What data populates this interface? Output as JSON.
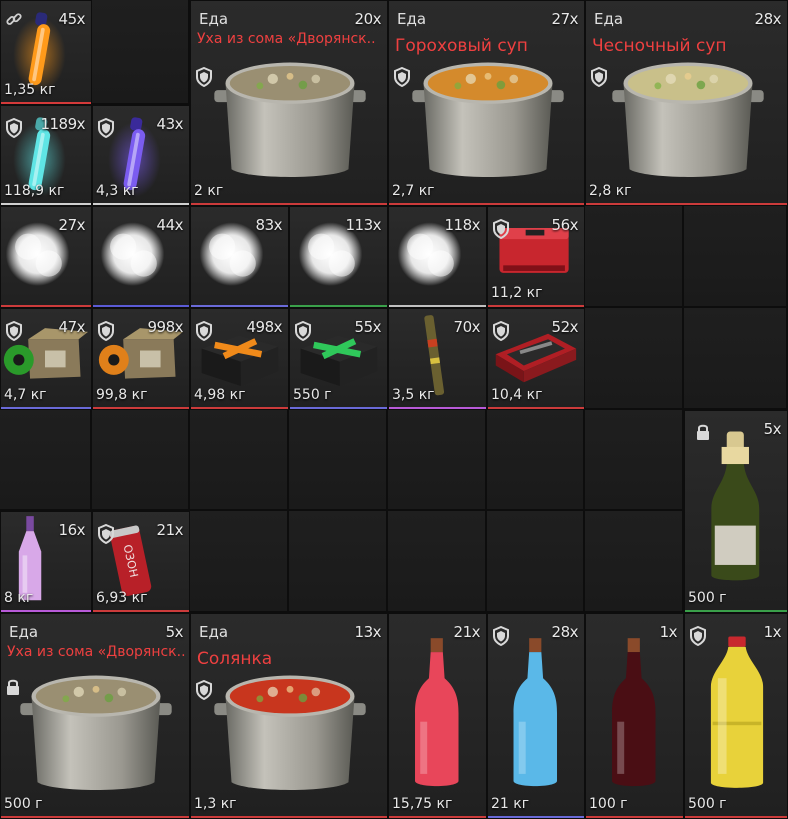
{
  "inventory": {
    "items": [
      {
        "id": "glow-orange",
        "kind": "glowstick",
        "count": "45x",
        "weight": "1,35 кг",
        "colors": {
          "tube": "#ff9a1a",
          "cap": "#2a2a78"
        },
        "rarity": "#d43a3a",
        "icon": "chain-link-icon"
      },
      {
        "id": "soup-ukha-1",
        "kind": "soup",
        "category": "Еда",
        "name": "Уха из сома «Дворянск..",
        "count": "20x",
        "weight": "2 кг",
        "colors": {
          "broth": "#9a8f72"
        },
        "rarity": "#cc3b3b",
        "icon": "shield-icon"
      },
      {
        "id": "soup-pea",
        "kind": "soup",
        "category": "Еда",
        "name": "Гороховый суп",
        "count": "27x",
        "weight": "2,7 кг",
        "colors": {
          "broth": "#d48a2c"
        },
        "rarity": "#cc3b3b",
        "icon": "shield-icon"
      },
      {
        "id": "soup-garlic",
        "kind": "soup",
        "category": "Еда",
        "name": "Чесночный суп",
        "count": "28x",
        "weight": "2,8 кг",
        "colors": {
          "broth": "#c9c08a"
        },
        "rarity": "#cc3b3b",
        "icon": "shield-icon"
      },
      {
        "id": "glow-cyan",
        "kind": "glowstick",
        "count": "1189x",
        "weight": "118,9 кг",
        "colors": {
          "tube": "#5fe5e5",
          "cap": "#4aa8a8"
        },
        "rarity": "#cfcfcf",
        "icon": "shield-icon"
      },
      {
        "id": "glow-purple",
        "kind": "glowstick",
        "count": "43x",
        "weight": "4,3 кг",
        "colors": {
          "tube": "#7b5cf0",
          "cap": "#3a2a9a"
        },
        "rarity": "#cfcfcf",
        "icon": "shield-icon"
      },
      {
        "id": "smoke-1",
        "kind": "smoke",
        "count": "27x",
        "weight": "",
        "rarity": "#cc3b3b"
      },
      {
        "id": "smoke-2",
        "kind": "smoke",
        "count": "44x",
        "weight": "",
        "rarity": "#5b5bd6"
      },
      {
        "id": "smoke-3",
        "kind": "smoke",
        "count": "83x",
        "weight": "",
        "rarity": "#6a6ad8"
      },
      {
        "id": "smoke-4",
        "kind": "smoke",
        "count": "113x",
        "weight": "",
        "rarity": "#3aa04a"
      },
      {
        "id": "smoke-5",
        "kind": "smoke",
        "count": "118x",
        "weight": "",
        "rarity": "#c0c0c0"
      },
      {
        "id": "case-red",
        "kind": "case",
        "count": "56x",
        "weight": "11,2 кг",
        "colors": {
          "body": "#c8262e"
        },
        "rarity": "#cc3b3b",
        "icon": "shield-icon"
      },
      {
        "id": "ammo-green",
        "kind": "ammobox",
        "count": "47x",
        "weight": "4,7 кг",
        "colors": {
          "tape": "#2a9a2a"
        },
        "rarity": "#6a6ad8",
        "icon": "shield-icon"
      },
      {
        "id": "ammo-orange",
        "kind": "ammobox",
        "count": "998x",
        "weight": "99,8 кг",
        "colors": {
          "tape": "#e0801a"
        },
        "rarity": "#cc3b3b",
        "icon": "shield-icon"
      },
      {
        "id": "kit-orange",
        "kind": "kit",
        "count": "498x",
        "weight": "4,98 кг",
        "colors": {
          "x": "#f08a1a"
        },
        "rarity": "#cc3b3b",
        "icon": "shield-icon"
      },
      {
        "id": "kit-green",
        "kind": "kit",
        "count": "55x",
        "weight": "550 г",
        "colors": {
          "x": "#2fc85a"
        },
        "rarity": "#6a6ad8",
        "icon": "shield-icon"
      },
      {
        "id": "flare",
        "kind": "flare",
        "count": "70x",
        "weight": "3,5 кг",
        "rarity": "#b85ad8"
      },
      {
        "id": "case-tools",
        "kind": "toolcase",
        "count": "52x",
        "weight": "10,4 кг",
        "colors": {
          "body": "#b01e24"
        },
        "rarity": "#cc3b3b",
        "icon": "shield-icon"
      },
      {
        "id": "champagne",
        "kind": "champagne",
        "count": "5x",
        "weight": "500 г",
        "rarity": "#3aa04a",
        "icon": "lock-icon"
      },
      {
        "id": "bottle-pink",
        "kind": "smallbottle",
        "count": "16x",
        "weight": "8 кг",
        "colors": {
          "liquid": "#d8a8e8"
        },
        "rarity": "#b85ad8"
      },
      {
        "id": "can-red",
        "kind": "can",
        "label": "ОЗОН",
        "count": "21x",
        "weight": "6,93 кг",
        "rarity": "#cc3b3b",
        "icon": "shield-icon"
      },
      {
        "id": "soup-ukha-2",
        "kind": "soup",
        "category": "Еда",
        "name": "Уха из сома «Дворянск..",
        "count": "5x",
        "weight": "500 г",
        "colors": {
          "broth": "#9a8f72"
        },
        "rarity": "#cc3b3b",
        "icon": "lock-icon"
      },
      {
        "id": "soup-solyanka",
        "kind": "soup",
        "category": "Еда",
        "name": "Солянка",
        "count": "13x",
        "weight": "1,3 кг",
        "colors": {
          "broth": "#c8361e"
        },
        "rarity": "#cc3b3b",
        "icon": "shield-icon"
      },
      {
        "id": "bottle-red",
        "kind": "bottle",
        "count": "21x",
        "weight": "15,75 кг",
        "colors": {
          "liquid": "#e8465a"
        },
        "rarity": "#cc3b3b"
      },
      {
        "id": "bottle-blue",
        "kind": "bottle",
        "count": "28x",
        "weight": "21 кг",
        "colors": {
          "liquid": "#5ab8e8"
        },
        "rarity": "#6a6ad8",
        "icon": "shield-icon"
      },
      {
        "id": "bottle-dark",
        "kind": "bottle",
        "count": "1x",
        "weight": "100 г",
        "colors": {
          "liquid": "#4a0e14"
        },
        "rarity": "#cc3b3b"
      },
      {
        "id": "bottle-juice",
        "kind": "pet",
        "count": "1x",
        "weight": "500 г",
        "colors": {
          "liquid": "#e8d23a"
        },
        "rarity": "#cc3b3b",
        "icon": "shield-icon"
      }
    ]
  }
}
